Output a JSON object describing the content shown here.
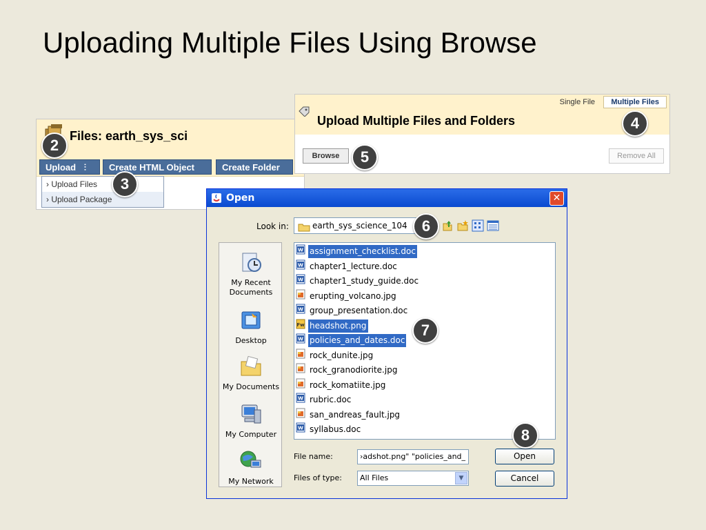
{
  "slide": {
    "title": "Uploading Multiple Files Using Browse"
  },
  "badges": {
    "b2": "2",
    "b3": "3",
    "b4": "4",
    "b5": "5",
    "b6": "6",
    "b7": "7",
    "b8": "8"
  },
  "files_panel": {
    "title": "Files: earth_sys_sci",
    "toolbar": {
      "upload": "Upload",
      "create_html": "Create HTML Object",
      "create_folder": "Create Folder"
    },
    "upload_menu": [
      "Upload Files",
      "Upload Package"
    ]
  },
  "multi_panel": {
    "title": "Upload Multiple Files and Folders",
    "tabs": {
      "single": "Single File",
      "multiple": "Multiple Files"
    },
    "browse": "Browse",
    "remove_all": "Remove All"
  },
  "dialog": {
    "title": "Open",
    "close": "✕",
    "look_in_label": "Look in:",
    "look_in_value": "earth_sys_science_104",
    "places": [
      "My Recent Documents",
      "Desktop",
      "My Documents",
      "My Computer",
      "My Network"
    ],
    "files": [
      {
        "name": "assignment_checklist.doc",
        "type": "doc",
        "selected": true
      },
      {
        "name": "chapter1_lecture.doc",
        "type": "doc",
        "selected": false
      },
      {
        "name": "chapter1_study_guide.doc",
        "type": "doc",
        "selected": false
      },
      {
        "name": "erupting_volcano.jpg",
        "type": "jpg",
        "selected": false
      },
      {
        "name": "group_presentation.doc",
        "type": "doc",
        "selected": false
      },
      {
        "name": "headshot.png",
        "type": "png",
        "selected": true
      },
      {
        "name": "policies_and_dates.doc",
        "type": "doc",
        "selected": true
      },
      {
        "name": "rock_dunite.jpg",
        "type": "jpg",
        "selected": false
      },
      {
        "name": "rock_granodiorite.jpg",
        "type": "jpg",
        "selected": false
      },
      {
        "name": "rock_komatiite.jpg",
        "type": "jpg",
        "selected": false
      },
      {
        "name": "rubric.doc",
        "type": "doc",
        "selected": false
      },
      {
        "name": "san_andreas_fault.jpg",
        "type": "jpg",
        "selected": false
      },
      {
        "name": "syllabus.doc",
        "type": "doc",
        "selected": false
      }
    ],
    "file_name_label": "File name:",
    "file_name_value": "›adshot.png\" \"policies_and_",
    "file_type_label": "Files of type:",
    "file_type_value": "All Files",
    "open_button": "Open",
    "cancel_button": "Cancel"
  }
}
